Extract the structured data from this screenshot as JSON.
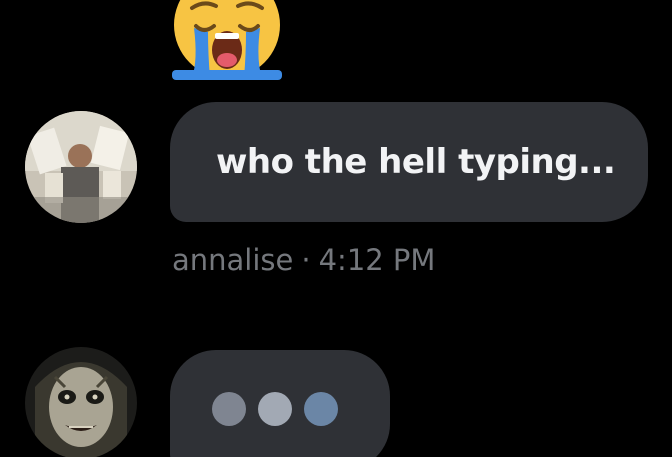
{
  "messages": {
    "incoming": {
      "text": "who the hell typing...",
      "sender": "annalise",
      "separator": "·",
      "time": "4:12 PM"
    },
    "reaction_emoji": "loudly-crying-face",
    "typing_indicator": {
      "dots": 3,
      "dot_colors": [
        "#7f8591",
        "#a2a9b4",
        "#6b86a6"
      ]
    }
  },
  "theme": {
    "background": "#000000",
    "bubble": "#2f3136",
    "text": "#f2f3f5",
    "meta_text": "#75787d"
  }
}
